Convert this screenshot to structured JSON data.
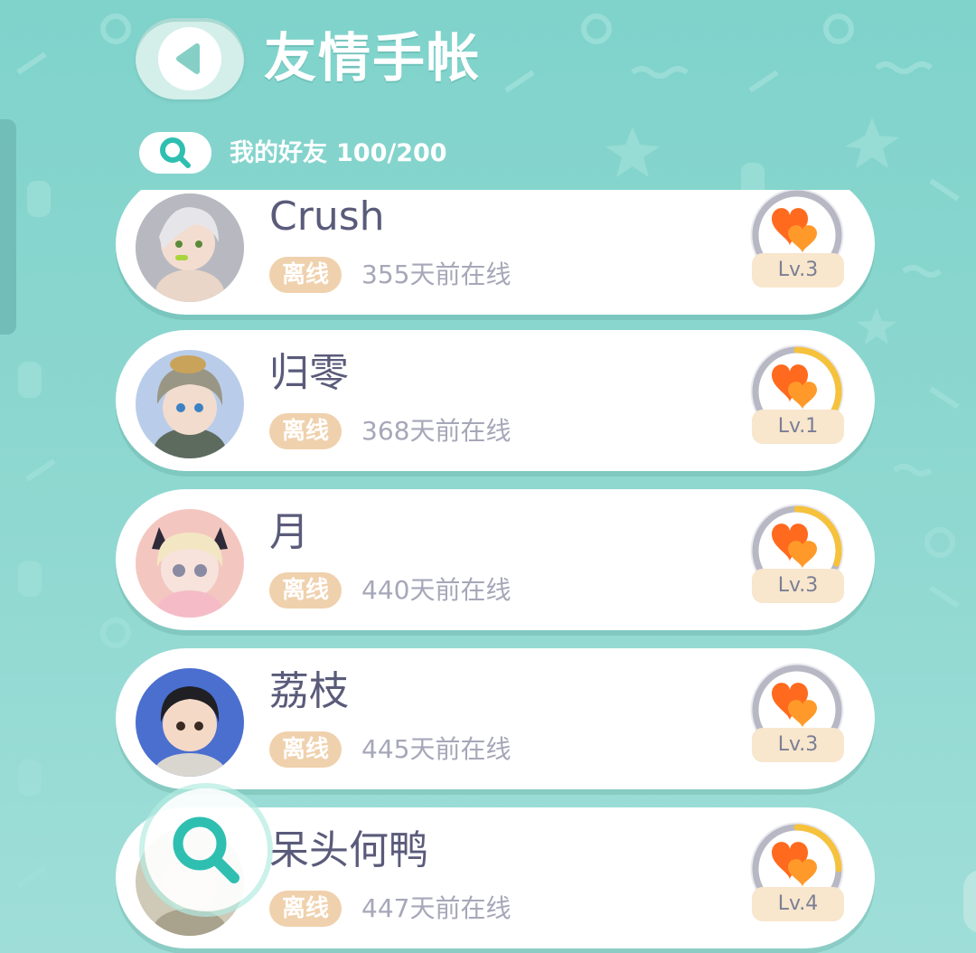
{
  "header": {
    "title": "友情手帐"
  },
  "subheader": {
    "friends_label": "我的好友",
    "friends_count": "100/200"
  },
  "friends": [
    {
      "name": "Crush",
      "status": "离线",
      "last_online": "355天前在线",
      "level": "Lv.3",
      "progress": 0.0
    },
    {
      "name": "归零",
      "status": "离线",
      "last_online": "368天前在线",
      "level": "Lv.1",
      "progress": 0.35
    },
    {
      "name": "月",
      "status": "离线",
      "last_online": "440天前在线",
      "level": "Lv.3",
      "progress": 0.3
    },
    {
      "name": "荔枝",
      "status": "离线",
      "last_online": "445天前在线",
      "level": "Lv.3",
      "progress": 0.0
    },
    {
      "name": "呆头何鸭",
      "status": "离线",
      "last_online": "447天前在线",
      "level": "Lv.4",
      "progress": 0.25
    }
  ],
  "colors": {
    "background": "#8fd8d1",
    "accent": "#2fbfb1",
    "title_text": "#5a5b7a",
    "status_badge": "#f0d1ad",
    "heart": "#ff6a1e",
    "ring_gold": "#f6c23c",
    "ring_gray": "#b8b8c4"
  },
  "icons": {
    "back": "chevron-left-icon",
    "search": "search-icon",
    "level": "heart-icon"
  }
}
